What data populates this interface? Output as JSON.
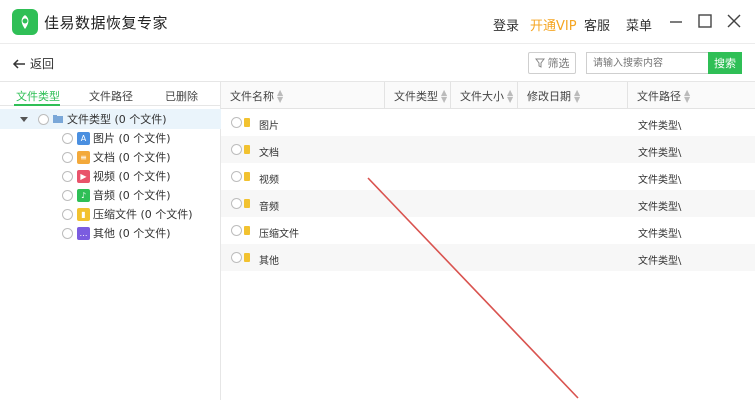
{
  "app": {
    "title": "佳易数据恢复专家",
    "login": "登录",
    "vip": "开通VIP",
    "service": "客服",
    "menu": "菜单",
    "brand_color": "#2fbf56",
    "vip_color": "#f5a623"
  },
  "toolbar": {
    "back_label": "返回",
    "filter_label": "筛选",
    "search_placeholder": "请输入搜索内容",
    "search_button": "搜索"
  },
  "left_tabs": [
    "文件类型",
    "文件路径",
    "已删除"
  ],
  "tree": {
    "root": "文件类型 (0 个文件)",
    "children": [
      {
        "label": "图片 (0 个文件)",
        "icon": "image-icon",
        "color": "#4a8fe0",
        "glyph": "A"
      },
      {
        "label": "文档 (0 个文件)",
        "icon": "document-icon",
        "color": "#f3a93b",
        "glyph": "≡"
      },
      {
        "label": "视频 (0 个文件)",
        "icon": "video-icon",
        "color": "#e9536b",
        "glyph": "▶"
      },
      {
        "label": "音频 (0 个文件)",
        "icon": "audio-icon",
        "color": "#2fbf56",
        "glyph": "♪"
      },
      {
        "label": "压缩文件 (0 个文件)",
        "icon": "archive-icon",
        "color": "#f2c230",
        "glyph": "▮"
      },
      {
        "label": "其他 (0 个文件)",
        "icon": "other-icon",
        "color": "#7b5ce0",
        "glyph": "…"
      }
    ]
  },
  "table": {
    "columns": [
      "文件名称",
      "文件类型",
      "文件大小",
      "修改日期",
      "文件路径"
    ],
    "rows": [
      {
        "name": "图片",
        "path": "文件类型\\"
      },
      {
        "name": "文档",
        "path": "文件类型\\"
      },
      {
        "name": "视频",
        "path": "文件类型\\"
      },
      {
        "name": "音频",
        "path": "文件类型\\"
      },
      {
        "name": "压缩文件",
        "path": "文件类型\\"
      },
      {
        "name": "其他",
        "path": "文件类型\\"
      }
    ]
  }
}
